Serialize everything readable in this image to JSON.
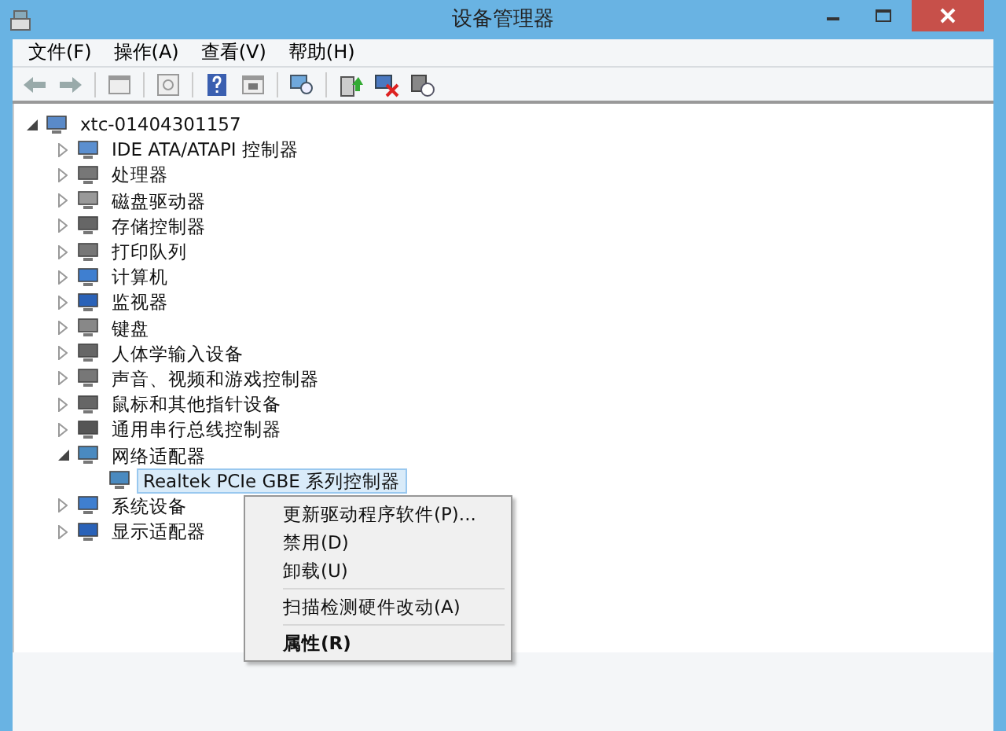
{
  "window": {
    "title": "设备管理器"
  },
  "menu": [
    "文件(F)",
    "操作(A)",
    "查看(V)",
    "帮助(H)"
  ],
  "tree": {
    "label": "xtc-01404301157",
    "expanded": true,
    "selected": false,
    "children": [
      {
        "label": "IDE ATA/ATAPI 控制器",
        "expanded": false,
        "selected": false
      },
      {
        "label": "处理器",
        "expanded": false,
        "selected": false
      },
      {
        "label": "磁盘驱动器",
        "expanded": false,
        "selected": false
      },
      {
        "label": "存储控制器",
        "expanded": false,
        "selected": false
      },
      {
        "label": "打印队列",
        "expanded": false,
        "selected": false
      },
      {
        "label": "计算机",
        "expanded": false,
        "selected": false
      },
      {
        "label": "监视器",
        "expanded": false,
        "selected": false
      },
      {
        "label": "键盘",
        "expanded": false,
        "selected": false
      },
      {
        "label": "人体学输入设备",
        "expanded": false,
        "selected": false
      },
      {
        "label": "声音、视频和游戏控制器",
        "expanded": false,
        "selected": false
      },
      {
        "label": "鼠标和其他指针设备",
        "expanded": false,
        "selected": false
      },
      {
        "label": "通用串行总线控制器",
        "expanded": false,
        "selected": false
      },
      {
        "label": "网络适配器",
        "expanded": true,
        "selected": false,
        "children": [
          {
            "label": "Realtek PCIe GBE 系列控制器",
            "selected": true
          }
        ]
      },
      {
        "label": "系统设备",
        "expanded": false,
        "selected": false
      },
      {
        "label": "显示适配器",
        "expanded": false,
        "selected": false
      }
    ]
  },
  "context_menu": [
    {
      "kind": "item",
      "label": "更新驱动程序软件(P)..."
    },
    {
      "kind": "item",
      "label": "禁用(D)"
    },
    {
      "kind": "item",
      "label": "卸载(U)"
    },
    {
      "kind": "separator"
    },
    {
      "kind": "item",
      "label": "扫描检测硬件改动(A)"
    },
    {
      "kind": "separator"
    },
    {
      "kind": "default",
      "label": "属性(R)"
    }
  ]
}
